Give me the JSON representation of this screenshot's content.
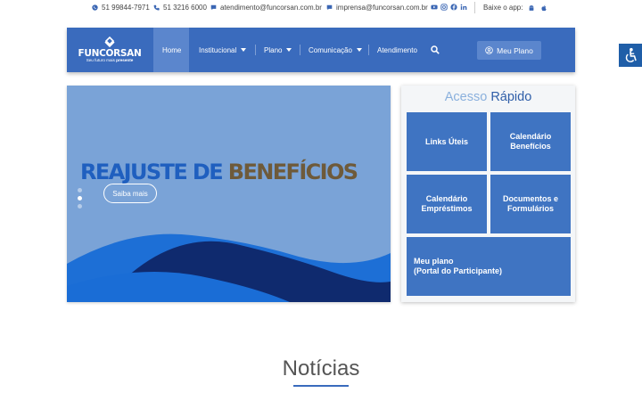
{
  "topbar": {
    "whatsapp": "51 99844-7971",
    "phone": "51 3216 6000",
    "email1": "atendimento@funcorsan.com.br",
    "email2": "imprensa@funcorsan.com.br",
    "app_label": "Baixe o app:"
  },
  "logo": {
    "name": "FUNCORSAN",
    "tagline_a": "Seu futuro mais ",
    "tagline_b": "presente"
  },
  "nav": {
    "home": "Home",
    "institucional": "Institucional",
    "plano": "Plano",
    "comunicacao": "Comunicação",
    "atendimento": "Atendimento",
    "meu_plano_button": "Meu Plano"
  },
  "slider": {
    "headline_part1": "REAJUSTE DE ",
    "headline_part2": "BENEFÍCIOS",
    "cta": "Saiba mais",
    "slides_count": 3,
    "active_slide": 2
  },
  "quick_access": {
    "title_part1": "Acesso ",
    "title_part2": "Rápido",
    "tiles": [
      {
        "line1": "Links Úteis",
        "line2": ""
      },
      {
        "line1": "Calendário",
        "line2": "Benefícios"
      },
      {
        "line1": "Calendário",
        "line2": "Empréstimos"
      },
      {
        "line1": "Documentos e",
        "line2": "Formulários"
      },
      {
        "line1": "Meu plano",
        "line2": "(Portal do Participante)"
      }
    ]
  },
  "news": {
    "title": "Notícias"
  },
  "colors": {
    "brand_blue": "#3a6bbd",
    "tile_blue": "#3f74c2",
    "slider_bg": "#7aa3d7"
  }
}
